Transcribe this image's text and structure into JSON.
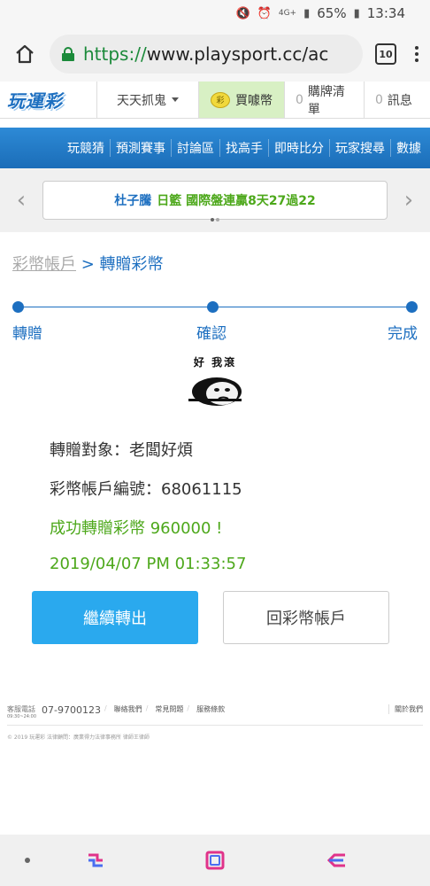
{
  "status_bar": {
    "battery": "65%",
    "time": "13:34",
    "network": "4G+"
  },
  "browser": {
    "url_scheme": "https://",
    "url_rest": "www.playsport.cc/ac",
    "tab_count": "10"
  },
  "site_nav": {
    "logo": "玩運彩",
    "hunt": "天天抓鬼",
    "coin_badge": "彩",
    "buy": "買噱幣",
    "list_count": "0",
    "list": "購牌清單",
    "msg_count": "0",
    "msg": "訊息"
  },
  "menu": [
    "玩競猜",
    "預測賽事",
    "討論區",
    "找高手",
    "即時比分",
    "玩家搜尋",
    "數據"
  ],
  "marquee": {
    "name": "杜子騰",
    "rest": "日籃 國際盤連贏8天27過22"
  },
  "breadcrumb": {
    "parent": "彩幣帳戶",
    "sep": " > ",
    "current": "轉贈彩幣"
  },
  "steps": [
    "轉贈",
    "確認",
    "完成"
  ],
  "meme_caption": "好 我滾",
  "info": {
    "target": "轉贈對象：老闆好煩",
    "account": "彩幣帳戶編號：68061115",
    "success": "成功轉贈彩幣 960000 !",
    "timestamp": "2019/04/07 PM 01:33:57"
  },
  "buttons": {
    "continue": "繼續轉出",
    "back": "回彩幣帳戶"
  },
  "footer": {
    "service_label": "客服電話",
    "service_hours": "09:30~24:00",
    "phone": "07-9700123",
    "links": [
      "聯絡我們",
      "常見問題",
      "服務條款"
    ],
    "right": "關於我們",
    "copyright": "© 2019 玩運彩 法律顧問：廣業得力法律事務所 律師王律師"
  }
}
